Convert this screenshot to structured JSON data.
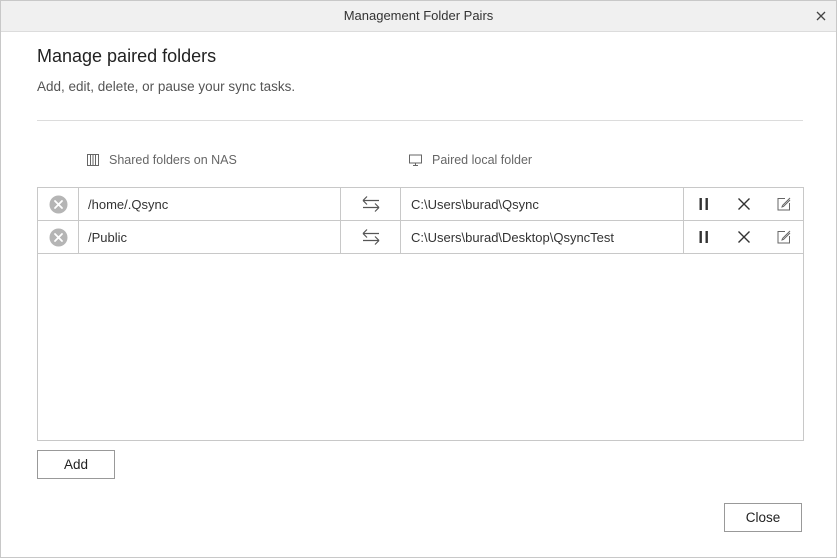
{
  "window": {
    "title": "Management Folder Pairs"
  },
  "header": {
    "heading": "Manage paired folders",
    "subheading": "Add, edit, delete, or pause your sync tasks."
  },
  "columns": {
    "nas": "Shared folders on NAS",
    "local": "Paired local folder"
  },
  "pairs": [
    {
      "nas": "/home/.Qsync",
      "local": "C:\\Users\\burad\\Qsync"
    },
    {
      "nas": "/Public",
      "local": "C:\\Users\\burad\\Desktop\\QsyncTest"
    }
  ],
  "icons": {
    "remove": "remove-circle-icon",
    "sync": "two-way-sync-arrows-icon",
    "pause": "pause-icon",
    "delete": "close-x-icon",
    "edit": "edit-pencil-icon",
    "nas": "nas-server-icon",
    "local": "monitor-icon"
  },
  "buttons": {
    "add": "Add",
    "close": "Close"
  },
  "colors": {
    "border": "#c8c8c8",
    "titlebar": "#f0f0f0",
    "icon_gray": "#b5b5b5"
  }
}
